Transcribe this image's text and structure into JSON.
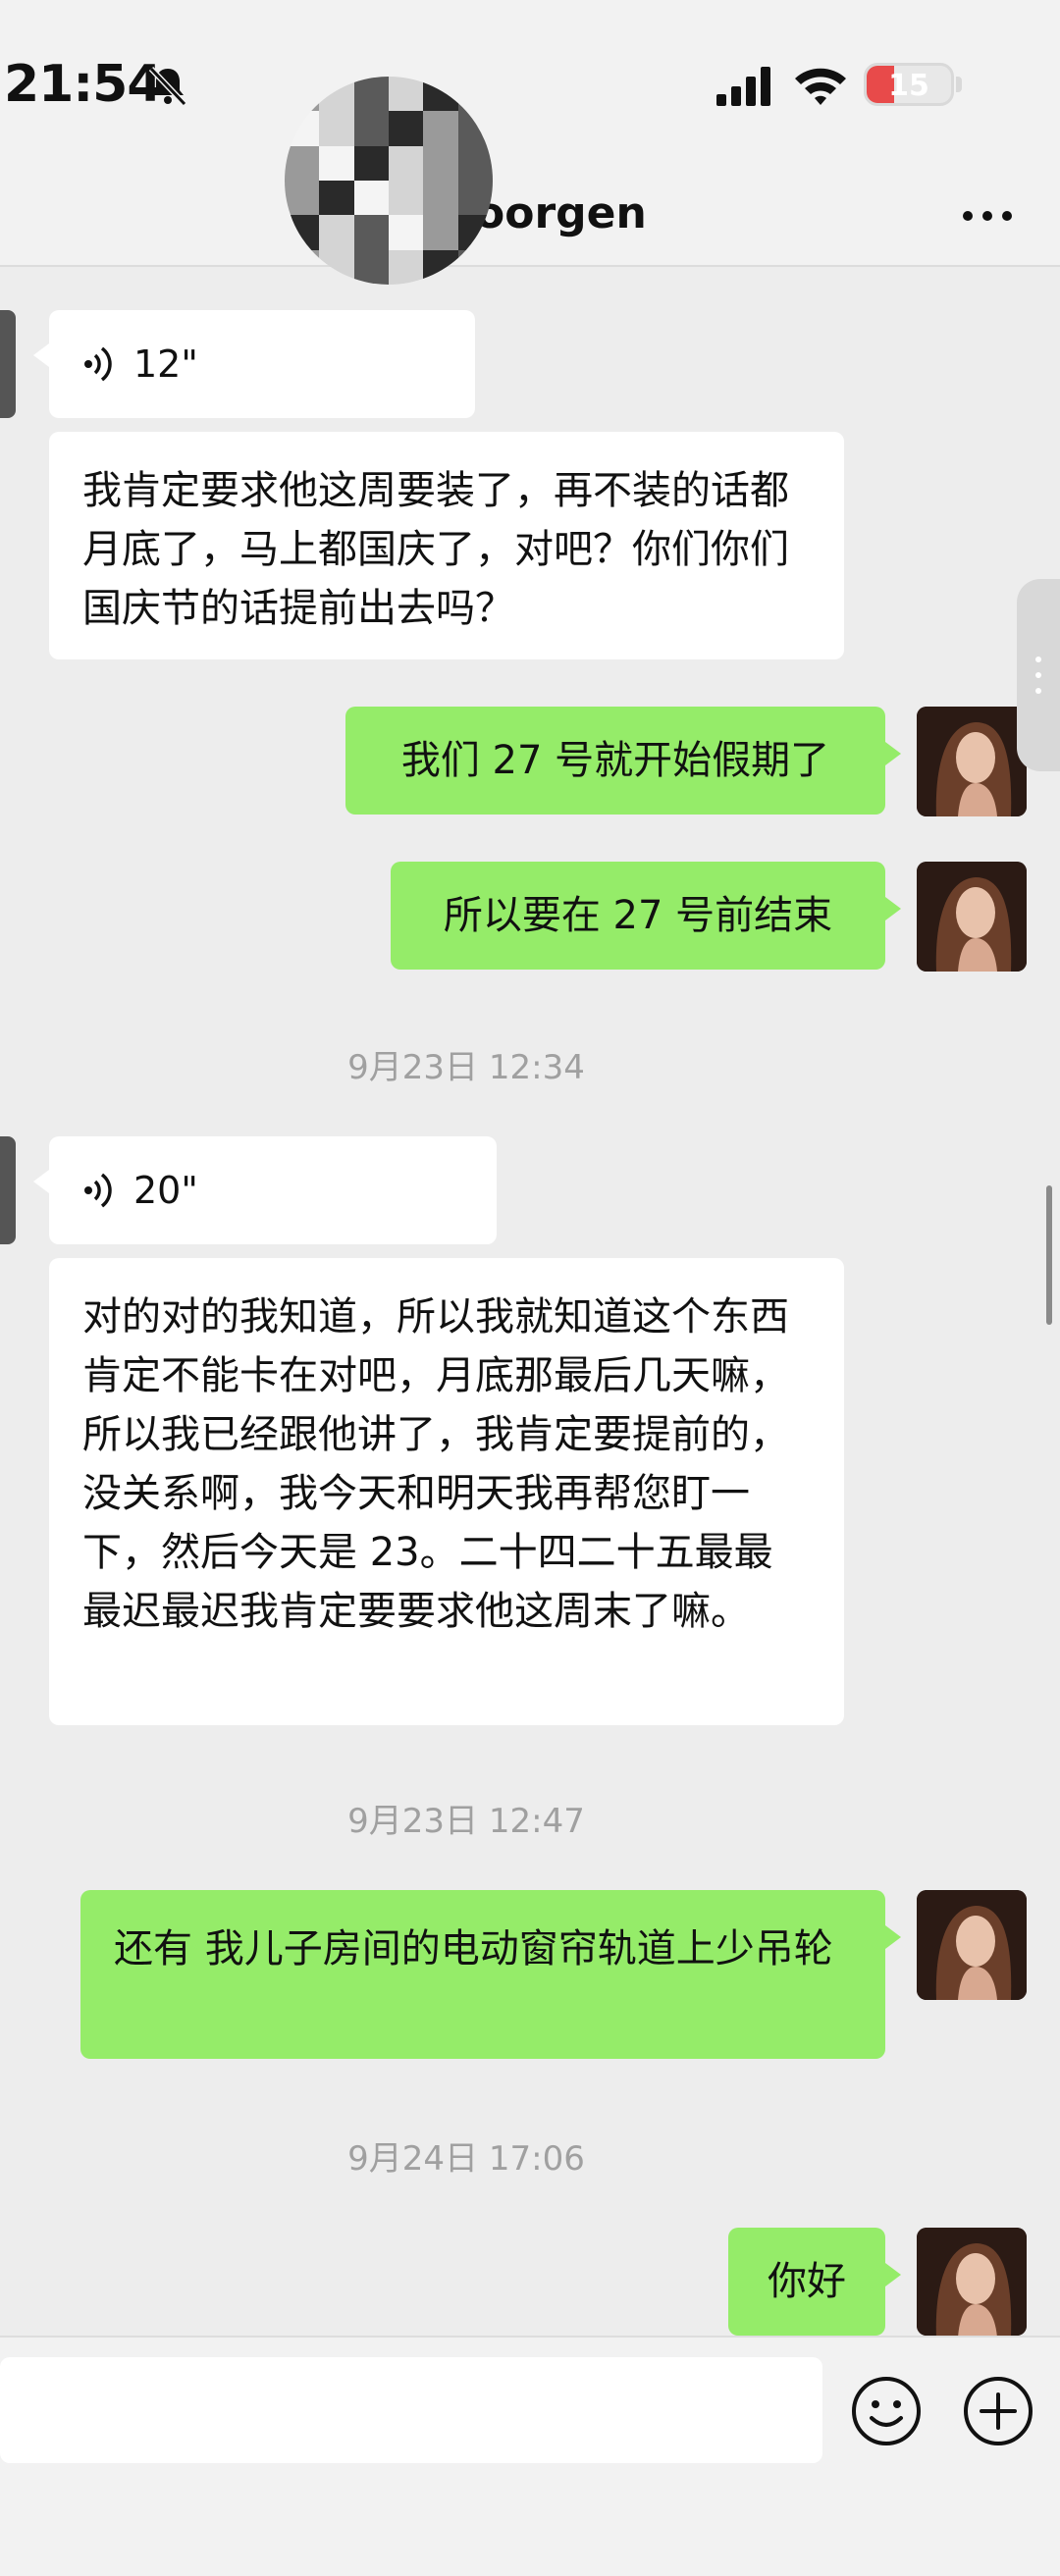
{
  "status_bar": {
    "time": "21:54",
    "battery_percent": "15",
    "battery_level": 0.15
  },
  "header": {
    "contact_name_visible": "oorgen"
  },
  "messages": [
    {
      "type": "voice-in",
      "duration": "12\""
    },
    {
      "type": "text-in",
      "text": "我肯定要求他这周要装了，再不装的话都月底了，马上都国庆了，对吧？你们你们国庆节的话提前出去吗？"
    },
    {
      "type": "text-out",
      "text": "我们 27 号就开始假期了"
    },
    {
      "type": "text-out",
      "text": "所以要在 27 号前结束"
    },
    {
      "type": "timestamp",
      "text": "9月23日 12:34"
    },
    {
      "type": "voice-in",
      "duration": "20\""
    },
    {
      "type": "text-in",
      "text": "对的对的我知道，所以我就知道这个东西肯定不能卡在对吧，月底那最后几天嘛，所以我已经跟他讲了，我肯定要提前的，没关系啊，我今天和明天我再帮您盯一下，然后今天是 23。二十四二十五最最最迟最迟我肯定要要求他这周末了嘛。"
    },
    {
      "type": "timestamp",
      "text": "9月23日 12:47"
    },
    {
      "type": "text-out",
      "text": "还有 我儿子房间的电动窗帘轨道上少吊轮"
    },
    {
      "type": "timestamp",
      "text": "9月24日 17:06"
    },
    {
      "type": "text-out",
      "text": "你好"
    }
  ],
  "input": {
    "value": ""
  },
  "colors": {
    "out_bubble": "#95ec69",
    "in_bubble": "#ffffff",
    "background": "#ededed"
  }
}
